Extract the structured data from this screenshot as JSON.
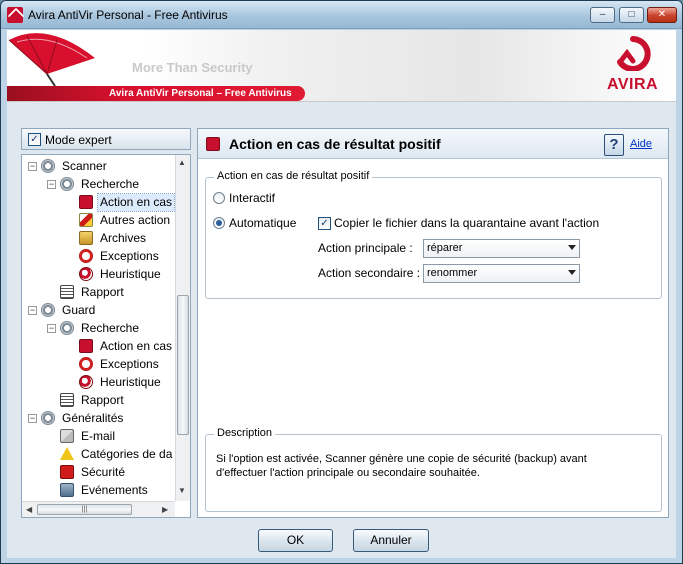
{
  "window": {
    "title": "Avira AntiVir Personal - Free Antivirus",
    "btn_min": "–",
    "btn_max": "□",
    "btn_close": "✕"
  },
  "banner": {
    "slogan": "More Than Security",
    "product": "Avira AntiVir Personal – Free Antivirus",
    "logo": "AVIRA",
    "accent": "#c8102e"
  },
  "left": {
    "mode_expert_label": "Mode expert",
    "mode_expert_checked": true,
    "tree": [
      {
        "label": "Scanner",
        "level": 0,
        "icon": "scanner-icon",
        "expander": "−"
      },
      {
        "label": "Recherche",
        "level": 1,
        "icon": "search-settings-icon",
        "expander": "−"
      },
      {
        "label": "Action en cas",
        "level": 2,
        "icon": "action-icon",
        "selected": true
      },
      {
        "label": "Autres action",
        "level": 2,
        "icon": "other-actions-icon"
      },
      {
        "label": "Archives",
        "level": 2,
        "icon": "archive-icon"
      },
      {
        "label": "Exceptions",
        "level": 2,
        "icon": "exceptions-icon"
      },
      {
        "label": "Heuristique",
        "level": 2,
        "icon": "heuristic-icon"
      },
      {
        "label": "Rapport",
        "level": 1,
        "icon": "report-icon"
      },
      {
        "label": "Guard",
        "level": 0,
        "icon": "guard-icon",
        "expander": "−"
      },
      {
        "label": "Recherche",
        "level": 1,
        "icon": "search-settings-icon",
        "expander": "−"
      },
      {
        "label": "Action en cas",
        "level": 2,
        "icon": "action-icon"
      },
      {
        "label": "Exceptions",
        "level": 2,
        "icon": "exceptions-icon"
      },
      {
        "label": "Heuristique",
        "level": 2,
        "icon": "heuristic-icon"
      },
      {
        "label": "Rapport",
        "level": 1,
        "icon": "report-icon"
      },
      {
        "label": "Généralités",
        "level": 0,
        "icon": "general-icon",
        "expander": "−"
      },
      {
        "label": "E-mail",
        "level": 1,
        "icon": "email-icon"
      },
      {
        "label": "Catégories de da",
        "level": 1,
        "icon": "warning-icon"
      },
      {
        "label": "Sécurité",
        "level": 1,
        "icon": "security-icon"
      },
      {
        "label": "Evénements",
        "level": 1,
        "icon": "events-icon"
      }
    ]
  },
  "right": {
    "title": "Action en cas de résultat positif",
    "help_label": "Aide",
    "group_title": "Action en cas de résultat positif",
    "radio_interactive": "Interactif",
    "radio_automatic": "Automatique",
    "selected_mode": "Automatique",
    "quarantine_label": "Copier le fichier dans la quarantaine avant l'action",
    "quarantine_checked": true,
    "primary_label": "Action principale :",
    "primary_value": "réparer",
    "secondary_label": "Action secondaire :",
    "secondary_value": "renommer",
    "description_title": "Description",
    "description_text": "Si l'option est activée, Scanner génère une copie de sécurité (backup) avant d'effectuer l'action principale ou secondaire souhaitée."
  },
  "footer": {
    "ok": "OK",
    "cancel": "Annuler"
  }
}
